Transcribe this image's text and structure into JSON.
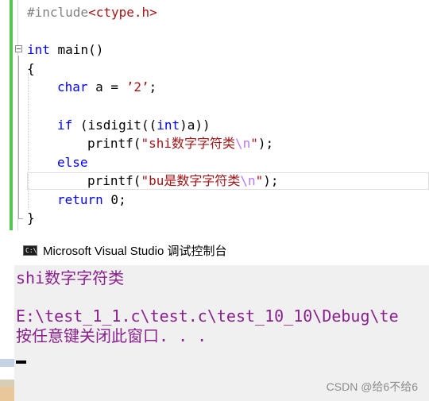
{
  "editor": {
    "include_directive": "#include",
    "include_header": "<ctype.h>",
    "sig_type": "int",
    "sig_rest": " main()",
    "open_brace": "{",
    "decl_type": "char",
    "decl_rest": " a = ",
    "decl_value": "’2’",
    "decl_end": ";",
    "if_kw": "if",
    "if_rest_1": " (isdigit((",
    "if_cast": "int",
    "if_rest_2": ")a))",
    "printf1_call": "printf(",
    "printf1_text": "\"shi数字字符类",
    "printf1_escape": "\\n",
    "printf1_close": "\"",
    "printf1_end": ");",
    "else_kw": "else",
    "printf2_call": "printf(",
    "printf2_text": "\"bu是数字字符类",
    "printf2_escape": "\\n",
    "printf2_close": "\"",
    "printf2_end": ");",
    "return_kw": "return",
    "return_rest": " 0;",
    "close_brace": "}"
  },
  "console": {
    "window_title": "Microsoft Visual Studio 调试控制台",
    "icon_label": "C:\\",
    "output_line": "shi数字字符类",
    "path_line": "E:\\test_1_1.c\\test.c\\test_10_10\\Debug\\te",
    "prompt_line": "按任意键关闭此窗口. . ."
  },
  "watermark": "CSDN @给6不给6",
  "colors": {
    "keyword": "#0000ff",
    "string": "#a31515",
    "escape": "#b776fb",
    "console_text": "#8a1f8e",
    "change_bar": "#57c554"
  }
}
